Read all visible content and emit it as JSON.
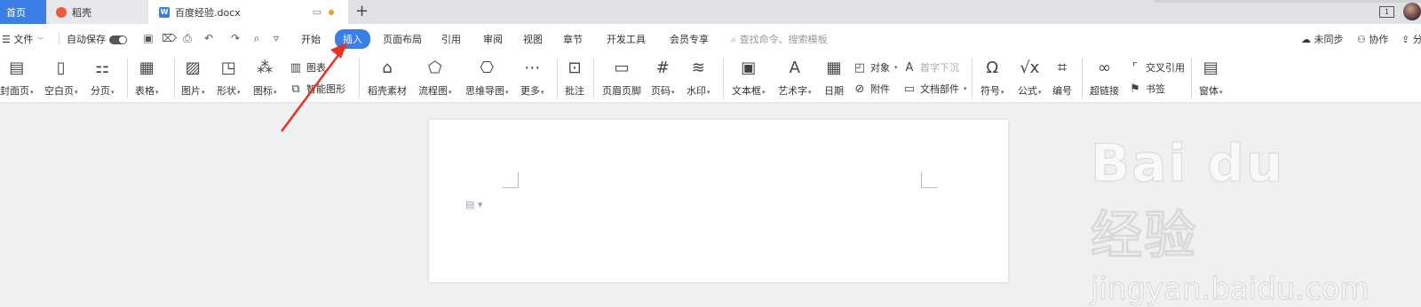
{
  "tabs": {
    "home": "首页",
    "wk": "稻壳",
    "doc": "百度经验.docx"
  },
  "menu": {
    "file": "文件",
    "autosave": "自动保存",
    "items": [
      "开始",
      "插入",
      "页面布局",
      "引用",
      "审阅",
      "视图",
      "章节",
      "开发工具",
      "会员专享"
    ],
    "active": "插入",
    "search_placeholder": "查找命令、搜索模板",
    "unsync": "未同步",
    "collab": "协作",
    "share": "分"
  },
  "ribbon": {
    "cover": "封面页",
    "blank": "空白页",
    "pagebreak": "分页",
    "table": "表格",
    "picture": "图片",
    "shape": "形状",
    "icon": "图标",
    "chart": "图表",
    "smartart": "智能图形",
    "dk_material": "稻壳素材",
    "flowchart": "流程图",
    "mindmap": "思维导图",
    "more": "更多",
    "comment": "批注",
    "header_footer": "页眉页脚",
    "page_num": "页码",
    "watermark": "水印",
    "textbox": "文本框",
    "wordart": "艺术字",
    "date": "日期",
    "object": "对象",
    "attachment": "附件",
    "dropcap": "首字下沉",
    "doc_parts": "文档部件",
    "symbol": "符号",
    "formula": "公式",
    "numbering": "编号",
    "hyperlink": "超链接",
    "crossref": "交叉引用",
    "bookmark": "书签",
    "window": "窗体"
  },
  "watermark": {
    "line1": "Bai du 经验",
    "line2": "jingyan.baidu.com"
  },
  "colors": {
    "accent": "#3a7ee6",
    "arrow": "#e8321e"
  }
}
